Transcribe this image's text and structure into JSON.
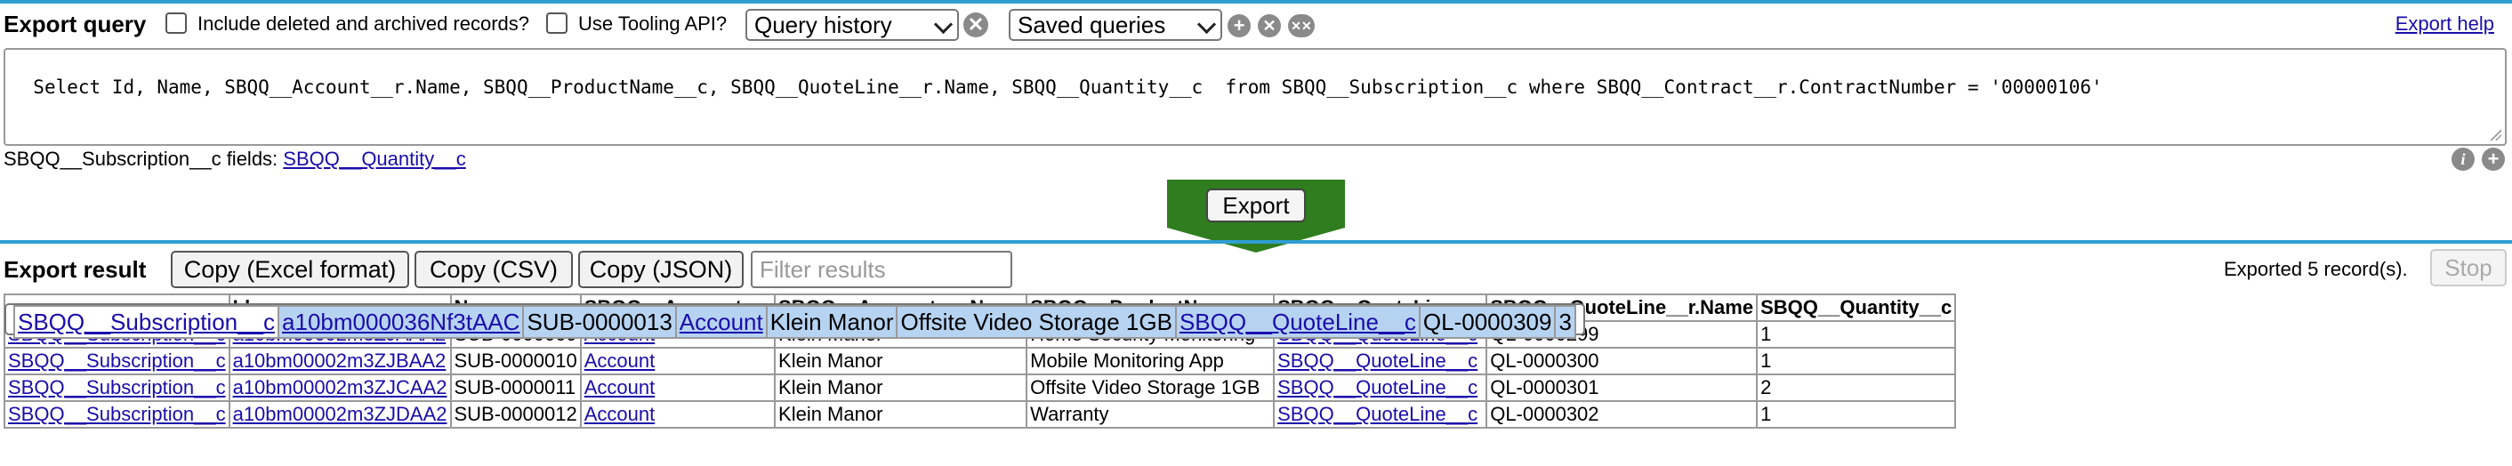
{
  "header": {
    "title": "Export query",
    "include_deleted_label": "Include deleted and archived records?",
    "tooling_label": "Use Tooling API?",
    "query_history": "Query history",
    "saved_queries": "Saved queries",
    "export_help": "Export help",
    "icons": [
      "clear-icon",
      "add-icon",
      "remove-icon",
      "remove-all-icon"
    ]
  },
  "query": {
    "text": "Select Id, Name, SBQQ__Account__r.Name, SBQQ__ProductName__c, SBQQ__QuoteLine__r.Name, SBQQ__Quantity__c  from SBQQ__Subscription__c where SBQQ__Contract__r.ContractNumber = '00000106'"
  },
  "fields_hint": {
    "prefix": "SBQQ__Subscription__c fields: ",
    "field": "SBQQ__Quantity__c"
  },
  "export_button": "Export",
  "result": {
    "title": "Export result",
    "copy_excel": "Copy (Excel format)",
    "copy_csv": "Copy (CSV)",
    "copy_json": "Copy (JSON)",
    "filter_placeholder": "Filter results",
    "status": "Exported 5 record(s).",
    "stop": "Stop",
    "columns": [
      "",
      "Id",
      "Name",
      "SBQQ__Account__r",
      "SBQQ__Account__r.Name",
      "SBQQ__ProductName__c",
      "SBQQ__QuoteLine__r",
      "SBQQ__QuoteLine__r.Name",
      "SBQQ__Quantity__c"
    ],
    "rows": [
      [
        "SBQQ__Subscription__c",
        "a10bm00002m3ZJAAA2",
        "SUB-0000009",
        "Account",
        "Klein Manor",
        "Home Security Monitoring",
        "SBQQ__QuoteLine__c",
        "QL-0000299",
        "1"
      ],
      [
        "SBQQ__Subscription__c",
        "a10bm00002m3ZJBAA2",
        "SUB-0000010",
        "Account",
        "Klein Manor",
        "Mobile Monitoring App",
        "SBQQ__QuoteLine__c",
        "QL-0000300",
        "1"
      ],
      [
        "SBQQ__Subscription__c",
        "a10bm00002m3ZJCAA2",
        "SUB-0000011",
        "Account",
        "Klein Manor",
        "Offsite Video Storage 1GB",
        "SBQQ__QuoteLine__c",
        "QL-0000301",
        "2"
      ],
      [
        "SBQQ__Subscription__c",
        "a10bm00002m3ZJDAA2",
        "SUB-0000012",
        "Account",
        "Klein Manor",
        "Warranty",
        "SBQQ__QuoteLine__c",
        "QL-0000302",
        "1"
      ],
      [
        "SBQQ__Subscription__c",
        "a10bm000036Nf3tAAC",
        "SUB-0000013",
        "Account",
        "Klein Manor",
        "Offsite Video Storage 1GB",
        "SBQQ__QuoteLine__c",
        "QL-0000309",
        "3"
      ]
    ],
    "selected_row": 4
  },
  "colors": {
    "accent": "#2e9fd1",
    "export_band": "#2f7d1f",
    "selection": "#b7d3f2",
    "link": "#1a0dab"
  }
}
